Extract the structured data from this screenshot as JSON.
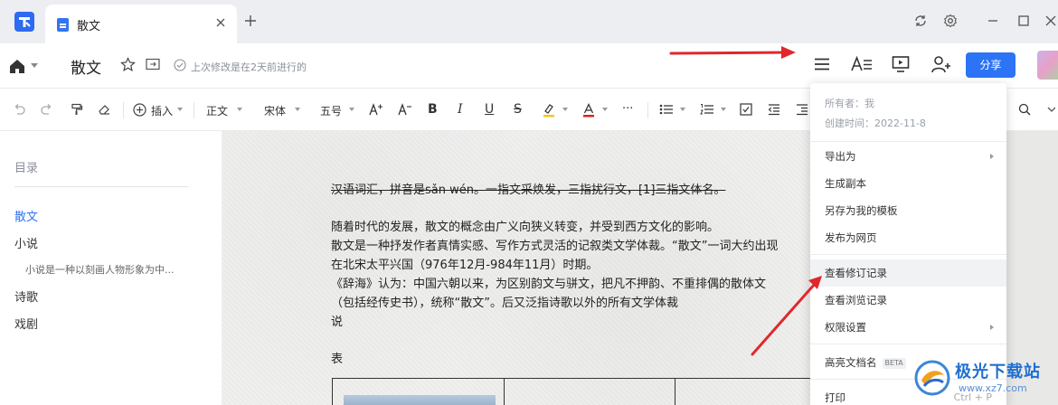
{
  "tab": {
    "title": "散文"
  },
  "header": {
    "doc_title": "散文",
    "save_status": "上次修改是在2天前进行的",
    "share_label": "分享"
  },
  "toolbar": {
    "insert_label": "插入",
    "style_label": "正文",
    "font_label": "宋体",
    "size_label": "五号",
    "bold": "B",
    "italic": "I",
    "underline": "U",
    "strike": "S",
    "more": "···"
  },
  "outline": {
    "title": "目录",
    "items": [
      {
        "label": "散文"
      },
      {
        "label": "小说"
      },
      {
        "label": "小说是一种以刻画人物形象为中..."
      },
      {
        "label": "诗歌"
      },
      {
        "label": "戏剧"
      }
    ]
  },
  "document": {
    "lines": [
      "汉语词汇，拼音是sǎn wén。一指文采焕发，三指扰行文，[1]三指文体名。",
      "随着时代的发展，散文的概念由广义向狭义转变，并受到西方文化的影响。",
      "散文是一种抒发作者真情实感、写作方式灵活的记叙类文学体裁。“散文”一词大约出现",
      "在北宋太平兴国（976年12月-984年11月）时期。",
      "《辞海》认为：中国六朝以来，为区别韵文与骈文，把凡不押韵、不重排偶的散体文",
      "（包括经传史书），统称“散文”。后又泛指诗歌以外的所有文学体裁",
      "说",
      "表"
    ]
  },
  "menu": {
    "owner": "所有者：我",
    "created": "创建时间：2022-11-8",
    "items": [
      {
        "label": "导出为",
        "submenu": true
      },
      {
        "label": "生成副本"
      },
      {
        "label": "另存为我的模板"
      },
      {
        "label": "发布为网页"
      },
      {
        "label": "查看修订记录",
        "highlighted": true
      },
      {
        "label": "查看浏览记录"
      },
      {
        "label": "权限设置",
        "submenu": true
      },
      {
        "label": "高亮文档名",
        "badge": "BETA"
      },
      {
        "label": "打印",
        "shortcut": "Ctrl + P"
      }
    ]
  },
  "watermark": {
    "name": "极光下载站",
    "url": "www.xz7.com"
  },
  "colors": {
    "accent": "#2c74f5",
    "annotation": "#e0282c",
    "highlight": "#f5c518",
    "font_color": "#e02020"
  },
  "icons": [
    "home-icon",
    "star-icon",
    "move-icon",
    "check-circle-icon",
    "menu-icon",
    "text-style-icon",
    "present-icon",
    "add-user-icon",
    "undo-icon",
    "redo-icon",
    "format-painter-icon",
    "eraser-icon",
    "search-icon"
  ]
}
